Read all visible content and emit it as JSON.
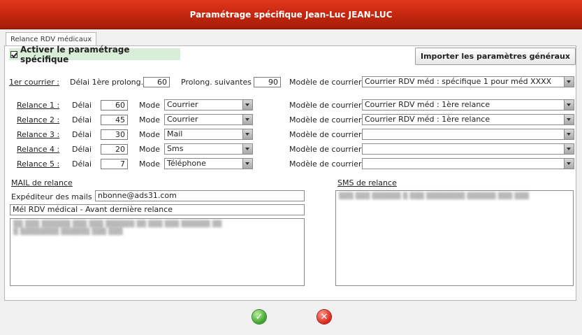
{
  "window": {
    "title": "Paramétrage spécifique Jean-Luc JEAN-LUC"
  },
  "tab": {
    "label": "Relance RDV médicaux"
  },
  "activate": {
    "label": "Activer le paramétrage spécifique",
    "checked": true
  },
  "import_button": {
    "label": "Importer les paramètres généraux"
  },
  "first_letter": {
    "label": "1er courrier :",
    "delay_label": "Délai 1ère prolong.",
    "delay_value": "60",
    "next_label": "Prolong. suivantes",
    "next_value": "90",
    "model_label": "Modèle de courrier",
    "model_value": "Courrier RDV méd : spécifique 1 pour méd XXXX"
  },
  "relances": [
    {
      "label": "Relance 1 :",
      "delay_label": "Délai",
      "delay": "60",
      "mode_label": "Mode",
      "mode": "Courrier",
      "model_label": "Modèle de courrier",
      "model": "Courrier RDV méd : 1ère relance"
    },
    {
      "label": "Relance 2 :",
      "delay_label": "Délai",
      "delay": "45",
      "mode_label": "Mode",
      "mode": "Courrier",
      "model_label": "Modèle de courrier",
      "model": "Courrier RDV méd : 1ère relance"
    },
    {
      "label": "Relance 3 :",
      "delay_label": "Délai",
      "delay": "30",
      "mode_label": "Mode",
      "mode": "Mail",
      "model_label": "Modèle de courrier",
      "model": ""
    },
    {
      "label": "Relance 4 :",
      "delay_label": "Délai",
      "delay": "20",
      "mode_label": "Mode",
      "mode": "Sms",
      "model_label": "Modèle de courrier",
      "model": ""
    },
    {
      "label": "Relance 5 :",
      "delay_label": "Délai",
      "delay": "7",
      "mode_label": "Mode",
      "mode": "Téléphone",
      "model_label": "Modèle de courrier",
      "model": ""
    }
  ],
  "mail": {
    "section_label": "MAIL de relance",
    "sender_label": "Expéditeur des mails",
    "sender_value": "nbonne@ads31.com",
    "subject_value": "Mél RDV médical - Avant dernière relance"
  },
  "sms": {
    "section_label": "SMS de relance"
  },
  "colors": {
    "title_bar": "#c92810",
    "activate_bg": "#d9eed9",
    "ok": "#3aa12b",
    "cancel": "#d7261b"
  }
}
